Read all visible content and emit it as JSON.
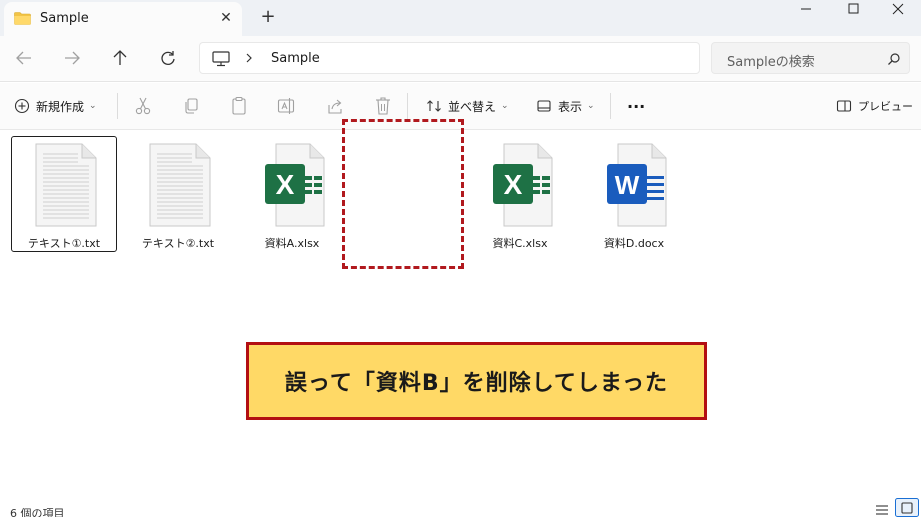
{
  "window": {
    "tab_title": "Sample",
    "tab_close": "✕",
    "new_tab": "+"
  },
  "navigation": {
    "breadcrumb": "Sample",
    "search_placeholder": "Sampleの検索"
  },
  "commandbar": {
    "new_label": "新規作成",
    "sort_label": "並べ替え",
    "view_label": "表示",
    "more_label": "...",
    "preview_label": "プレビュー"
  },
  "files": [
    {
      "name": "テキスト①.txt",
      "type": "txt",
      "selected": true
    },
    {
      "name": "テキスト②.txt",
      "type": "txt",
      "selected": false
    },
    {
      "name": "資料A.xlsx",
      "type": "excel",
      "selected": false
    },
    {
      "name": "資料C.xlsx",
      "type": "excel",
      "selected": false
    },
    {
      "name": "資料D.docx",
      "type": "word",
      "selected": false
    }
  ],
  "callout": {
    "text": "誤って「資料B」を削除してしまった"
  },
  "statusbar": {
    "item_count": "6 個の項目"
  },
  "colors": {
    "excel_green": "#1e7145",
    "word_blue": "#1a5cbd",
    "folder_yellow": "#f2c447",
    "callout_fill": "#ffd966",
    "callout_border": "#b30f12",
    "dashed_red": "#b1191e",
    "accent_blue": "#1a6fd4"
  },
  "icons": {
    "tab": "folder-icon",
    "nav": [
      "back-arrow-icon",
      "forward-arrow-icon",
      "up-arrow-icon",
      "refresh-icon"
    ],
    "toolbar": [
      "cut-icon",
      "copy-icon",
      "paste-icon",
      "rename-icon",
      "share-icon",
      "delete-icon"
    ],
    "view_toggles": [
      "details-view-icon",
      "large-icons-view-icon"
    ]
  }
}
